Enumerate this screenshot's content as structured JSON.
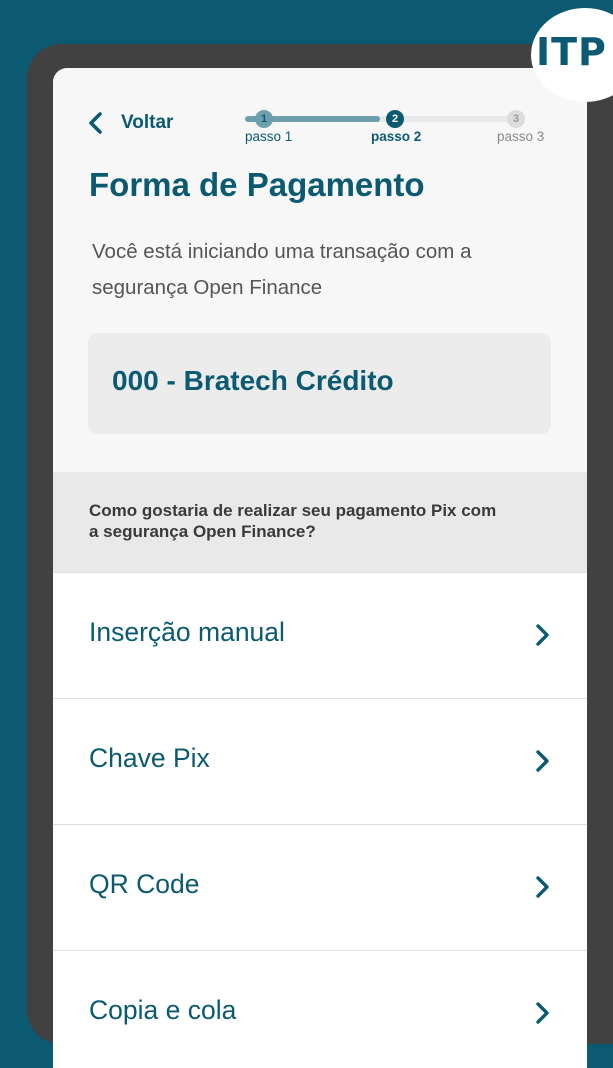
{
  "badge": {
    "text": "ITP"
  },
  "header": {
    "back_label": "Voltar"
  },
  "stepper": {
    "progress": 0.5,
    "steps": [
      {
        "number": "1",
        "label": "passo 1",
        "state": "done"
      },
      {
        "number": "2",
        "label": "passo 2",
        "state": "current"
      },
      {
        "number": "3",
        "label": "passo 3",
        "state": "pending"
      }
    ]
  },
  "main": {
    "title": "Forma de Pagamento",
    "intro": "Você está iniciando uma transação com a segurança Open Finance",
    "bank_name": "000 - Bratech Crédito",
    "question": "Como gostaria de realizar seu pagamento Pix com a segurança Open Finance?"
  },
  "options": [
    {
      "label": "Inserção manual",
      "icon": "chevron-right-icon"
    },
    {
      "label": "Chave Pix",
      "icon": "chevron-right-icon"
    },
    {
      "label": "QR Code",
      "icon": "chevron-right-icon"
    },
    {
      "label": "Copia e cola",
      "icon": "chevron-right-icon"
    }
  ],
  "colors": {
    "background": "#0b5a72",
    "accent": "#0b5a72",
    "stepper_done": "#6e9fad",
    "card": "#ececec"
  }
}
